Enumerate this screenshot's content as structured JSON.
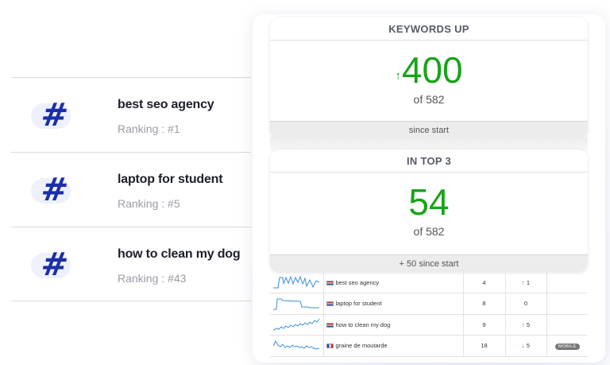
{
  "keywords": [
    {
      "title": "best seo agency",
      "rank": "Ranking : #1"
    },
    {
      "title": "laptop for student",
      "rank": "Ranking : #5"
    },
    {
      "title": "how to clean my dog",
      "rank": "Ranking : #43"
    }
  ],
  "hash_symbol": "#",
  "panels": {
    "keywords_up": {
      "title": "KEYWORDS UP",
      "arrow": "↑",
      "value": "400",
      "sub": "of 582",
      "footer": "since start"
    },
    "in_top3": {
      "title": "IN TOP 3",
      "value": "54",
      "sub": "of 582",
      "footer": "+ 50 since start"
    }
  },
  "table": {
    "rows": [
      {
        "keyword": "best seo agency",
        "flag": "us",
        "position": "4",
        "change_arrow": "↑",
        "change": "1",
        "direction": "up",
        "device": ""
      },
      {
        "keyword": "laptop for student",
        "flag": "us",
        "position": "8",
        "change_arrow": "",
        "change": "0",
        "direction": "none",
        "device": ""
      },
      {
        "keyword": "how to clean my dog",
        "flag": "us",
        "position": "9",
        "change_arrow": "↑",
        "change": "5",
        "direction": "up",
        "device": ""
      },
      {
        "keyword": "graine de moutarde",
        "flag": "fr",
        "position": "18",
        "change_arrow": "↓",
        "change": "5",
        "direction": "down",
        "device": "MOBILE"
      }
    ]
  },
  "colors": {
    "accent_green": "#1aa31a",
    "hash_blue": "#1a2fa8",
    "down_red": "#dd2222"
  }
}
